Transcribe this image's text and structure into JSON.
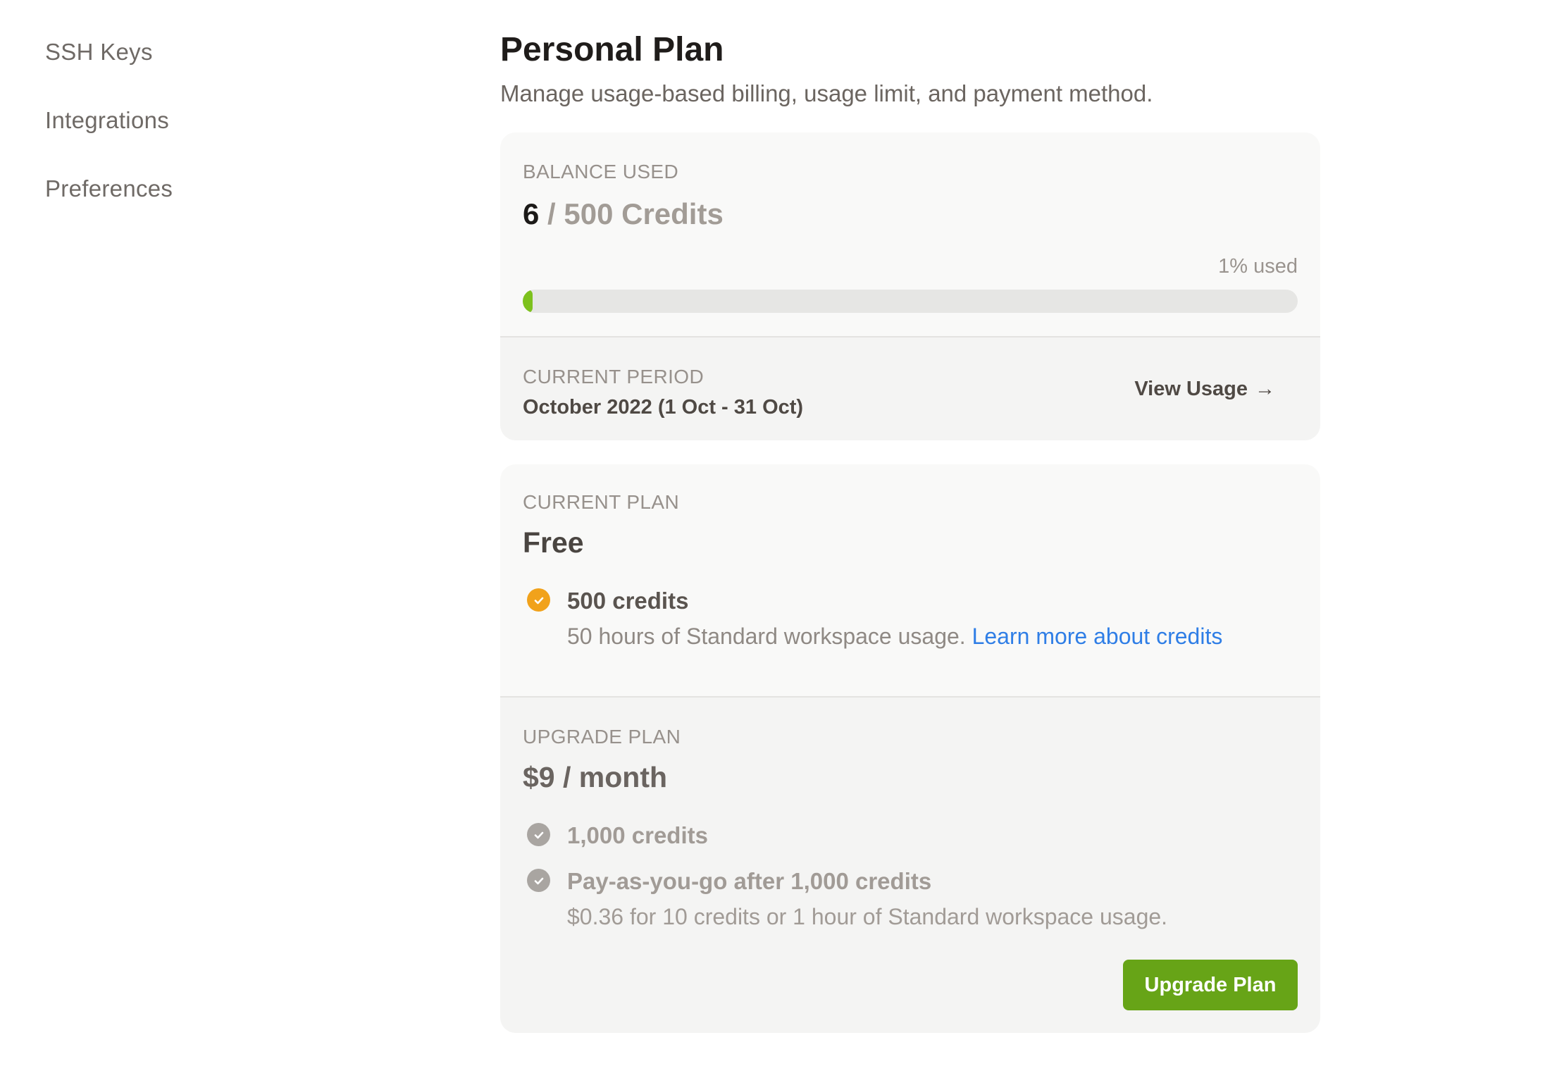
{
  "sidebar": {
    "items": [
      {
        "label": "SSH Keys"
      },
      {
        "label": "Integrations"
      },
      {
        "label": "Preferences"
      }
    ]
  },
  "header": {
    "title": "Personal Plan",
    "subtitle": "Manage usage-based billing, usage limit, and payment method."
  },
  "balance": {
    "label": "BALANCE USED",
    "used": "6",
    "total": " / 500 Credits",
    "percent_text": "1% used",
    "progress_fraction": 0.01,
    "progress_color": "#7dc11d"
  },
  "period": {
    "label": "CURRENT PERIOD",
    "value": "October 2022 (1 Oct - 31 Oct)",
    "view_usage_label": "View Usage",
    "view_usage_arrow": "→"
  },
  "current_plan": {
    "label": "CURRENT PLAN",
    "name": "Free",
    "features": [
      {
        "icon": "check-circle-icon",
        "icon_color": "#f1a21b",
        "title": "500 credits",
        "description": "50 hours of Standard workspace usage. ",
        "link_text": "Learn more about credits"
      }
    ]
  },
  "upgrade_plan": {
    "label": "UPGRADE PLAN",
    "price": "$9 / month",
    "features": [
      {
        "icon": "check-circle-icon",
        "icon_color": "#a9a5a1",
        "title": "1,000 credits"
      },
      {
        "icon": "check-circle-icon",
        "icon_color": "#a9a5a1",
        "title": "Pay-as-you-go after 1,000 credits",
        "description": "$0.36 for 10 credits or 1 hour of Standard workspace usage."
      }
    ],
    "button_label": "Upgrade Plan",
    "button_color": "#67a417"
  },
  "colors": {
    "link": "#2f7ee6",
    "card_background": "#f9f9f8"
  }
}
